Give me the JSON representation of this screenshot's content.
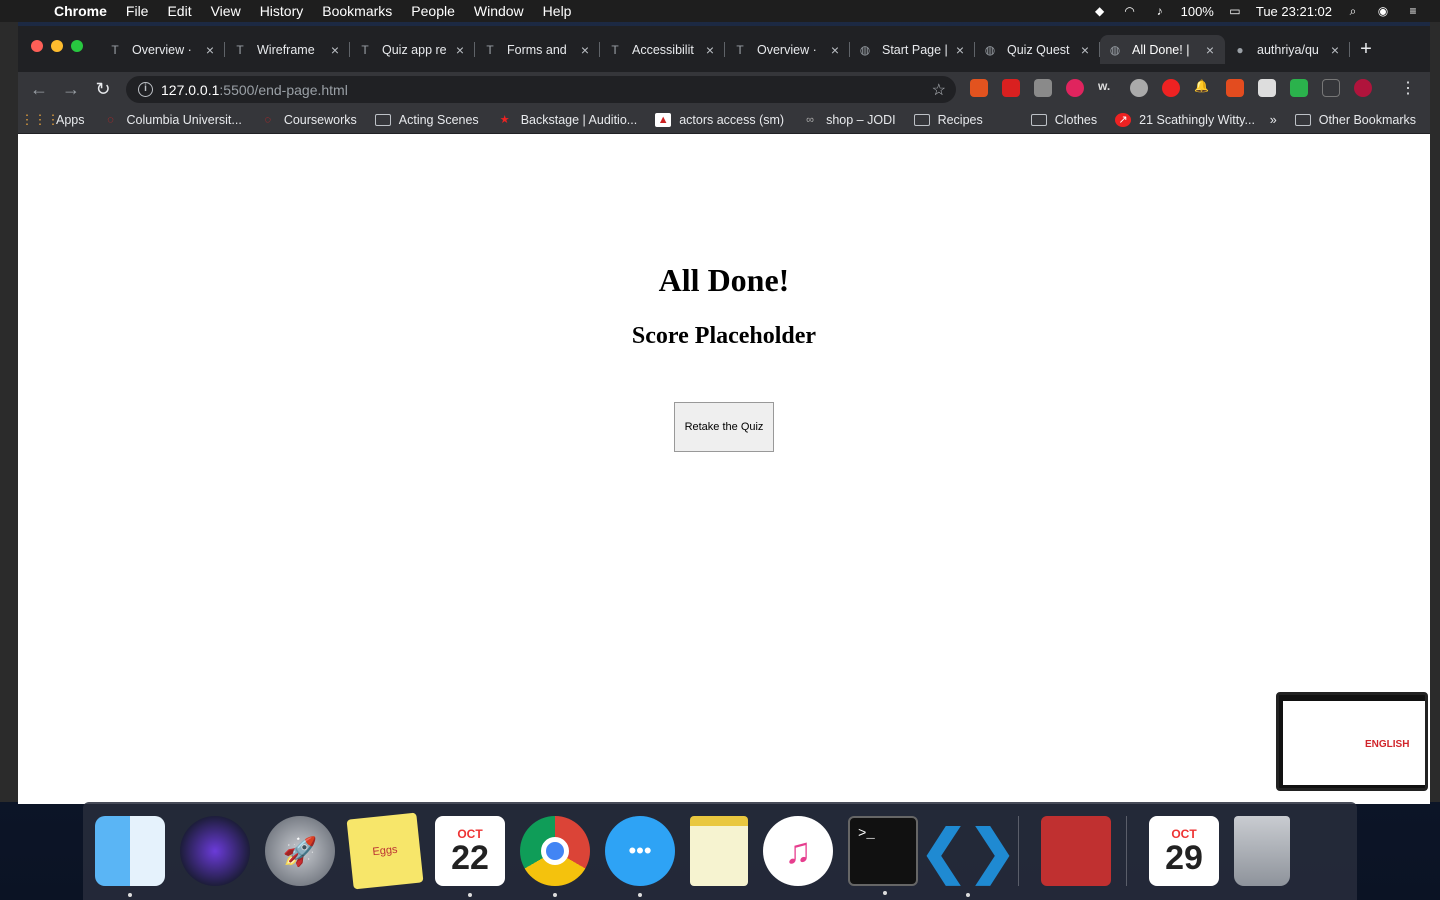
{
  "menubar": {
    "app": "Chrome",
    "items": [
      "File",
      "Edit",
      "View",
      "History",
      "Bookmarks",
      "People",
      "Window",
      "Help"
    ],
    "battery": "100%",
    "clock": "Tue 23:21:02"
  },
  "tabs": [
    {
      "title": "Overview ·"
    },
    {
      "title": "Wireframe"
    },
    {
      "title": "Quiz app re"
    },
    {
      "title": "Forms and"
    },
    {
      "title": "Accessibilit"
    },
    {
      "title": "Overview ·"
    },
    {
      "title": "Start Page |"
    },
    {
      "title": "Quiz Quest"
    },
    {
      "title": "All Done! |"
    },
    {
      "title": "authriya/qu"
    }
  ],
  "address": {
    "host": "127.0.0.1",
    "path": ":5500/end-page.html"
  },
  "bookmarks": {
    "items": [
      {
        "label": "Apps"
      },
      {
        "label": "Columbia Universit..."
      },
      {
        "label": "Courseworks"
      },
      {
        "label": "Acting Scenes"
      },
      {
        "label": "Backstage | Auditio..."
      },
      {
        "label": "actors access (sm)"
      },
      {
        "label": "shop – JODI"
      },
      {
        "label": "Recipes"
      },
      {
        "label": "Clothes"
      },
      {
        "label": "21 Scathingly Witty..."
      }
    ],
    "overflow": "»",
    "other": "Other Bookmarks"
  },
  "page": {
    "heading": "All Done!",
    "score": "Score Placeholder",
    "retake_label": "Retake the Quiz"
  },
  "pip": {
    "text": "ENGLISH"
  },
  "dock": {
    "stickies_text": "Eggs",
    "calendar_month": "OCT",
    "calendar_day": "22",
    "calendar2_month": "OCT",
    "calendar2_day": "29",
    "terminal_prompt": ">_"
  }
}
